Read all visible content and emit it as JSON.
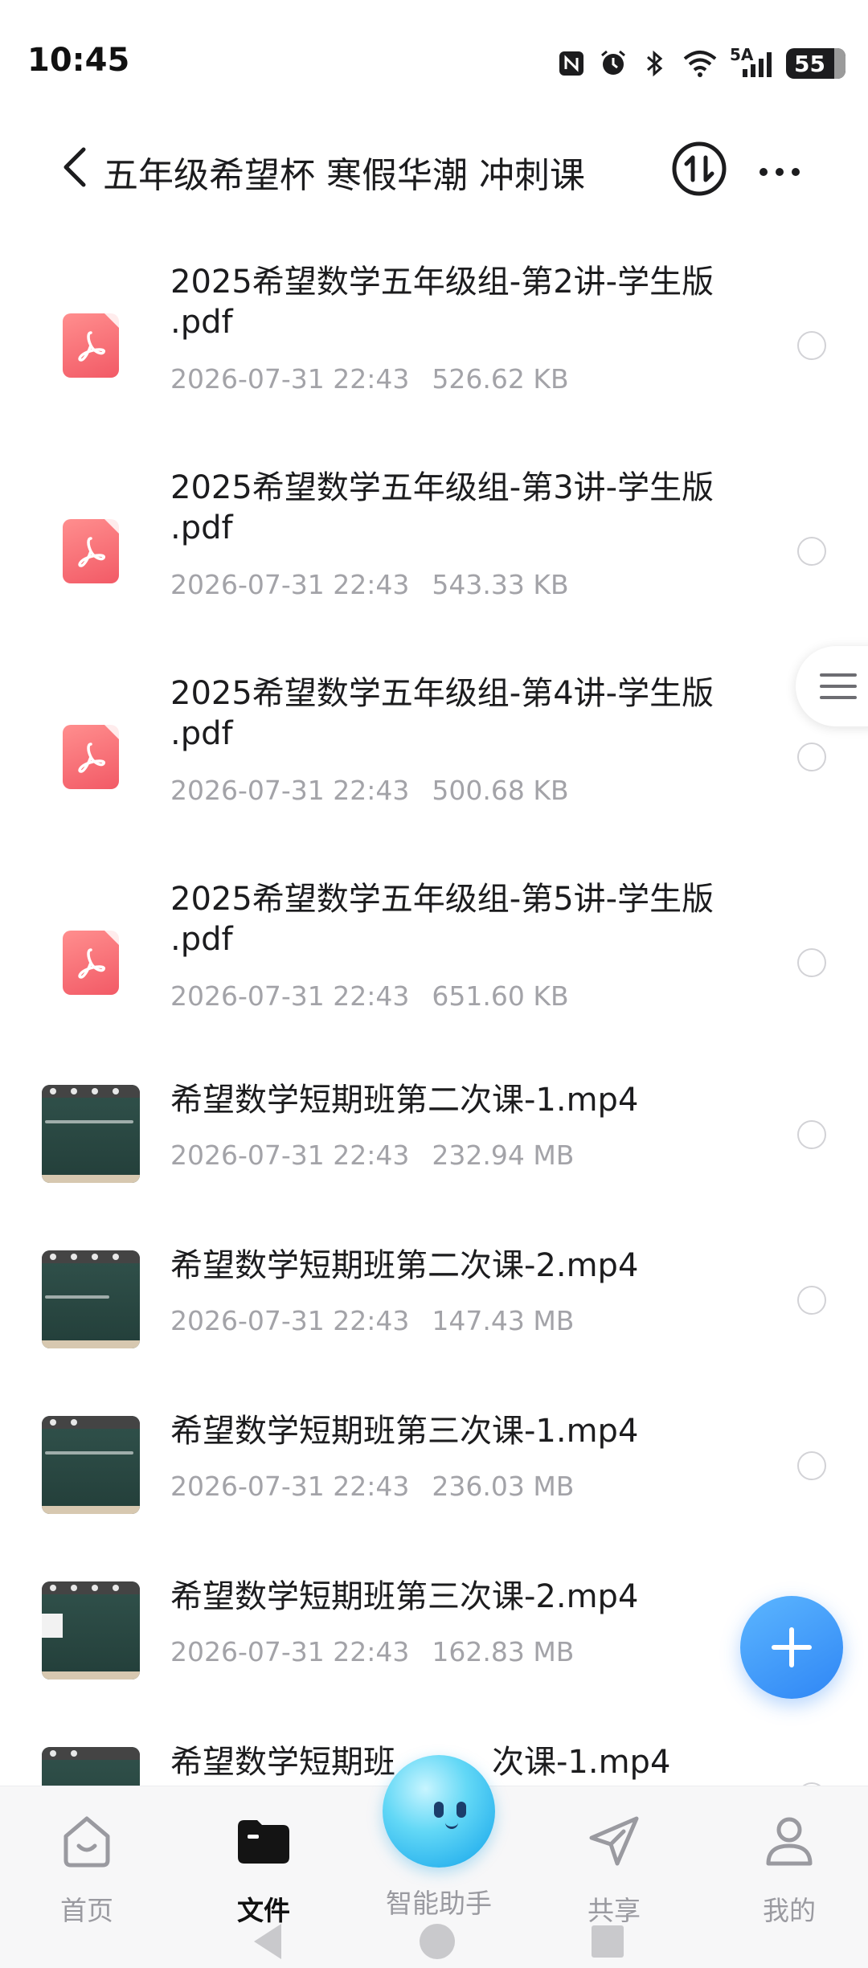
{
  "status_bar": {
    "time": "10:45",
    "network": "5A",
    "battery": "55",
    "icons": [
      "nfc-icon",
      "alarm-icon",
      "bluetooth-icon",
      "wifi-icon",
      "signal-icon",
      "battery-icon"
    ]
  },
  "header": {
    "title": "五年级希望杯 寒假华潮 冲刺课",
    "icons": [
      "back-arrow-icon",
      "transfer-icon",
      "more-icon"
    ]
  },
  "files": [
    {
      "type": "pdf",
      "name": "2025希望数学五年级组-第2讲-学生版.pdf",
      "name_line1": "2025希望数学五年级组-第2讲-学生版",
      "name_line2": ".pdf",
      "date": "2026-07-31 22:43",
      "size": "526.62 KB"
    },
    {
      "type": "pdf",
      "name": "2025希望数学五年级组-第3讲-学生版.pdf",
      "name_line1": "2025希望数学五年级组-第3讲-学生版",
      "name_line2": ".pdf",
      "date": "2026-07-31 22:43",
      "size": "543.33 KB"
    },
    {
      "type": "pdf",
      "name": "2025希望数学五年级组-第4讲-学生版.pdf",
      "name_line1": "2025希望数学五年级组-第4讲-学生版",
      "name_line2": ".pdf",
      "date": "2026-07-31 22:43",
      "size": "500.68 KB"
    },
    {
      "type": "pdf",
      "name": "2025希望数学五年级组-第5讲-学生版.pdf",
      "name_line1": "2025希望数学五年级组-第5讲-学生版",
      "name_line2": ".pdf",
      "date": "2026-07-31 22:43",
      "size": "651.60 KB"
    },
    {
      "type": "video",
      "name": "希望数学短期班第二次课-1.mp4",
      "date": "2026-07-31 22:43",
      "size": "232.94 MB"
    },
    {
      "type": "video",
      "name": "希望数学短期班第二次课-2.mp4",
      "date": "2026-07-31 22:43",
      "size": "147.43 MB"
    },
    {
      "type": "video",
      "name": "希望数学短期班第三次课-1.mp4",
      "date": "2026-07-31 22:43",
      "size": "236.03 MB"
    },
    {
      "type": "video",
      "name": "希望数学短期班第三次课-2.mp4",
      "date": "2026-07-31 22:43",
      "size": "162.83 MB"
    },
    {
      "type": "video",
      "name_prefix": "希望数学短期班",
      "name_suffix": "次课-1.mp4"
    }
  ],
  "fab": {
    "icon": "plus-icon"
  },
  "side_handle": {
    "icon": "menu-icon"
  },
  "bottom_nav": {
    "items": [
      {
        "label": "首页",
        "icon": "home-icon",
        "active": false
      },
      {
        "label": "文件",
        "icon": "folder-icon",
        "active": true
      },
      {
        "label": "智能助手",
        "icon": "assistant-orb-icon",
        "active": false
      },
      {
        "label": "共享",
        "icon": "share-icon",
        "active": false
      },
      {
        "label": "我的",
        "icon": "profile-icon",
        "active": false
      }
    ]
  },
  "colors": {
    "pdf_icon": "#f25a66",
    "fab": "#2f86f5",
    "meta_text": "#a3a3a8",
    "nav_inactive": "#9a9aa0",
    "assistant": "#2cb4ee"
  }
}
